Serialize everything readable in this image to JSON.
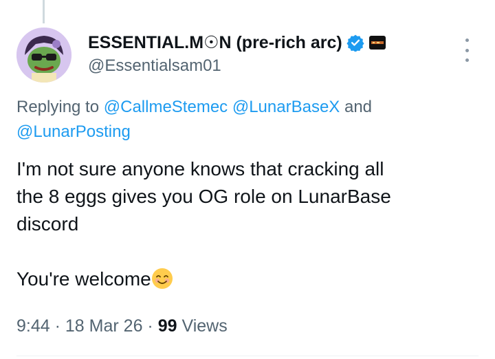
{
  "tweet": {
    "display_name": "ESSENTIAL.M☉N (pre-rich arc)",
    "handle": "@Essentialsam01",
    "replying_prefix": "Replying to",
    "mentions": [
      "@CallmeStemec",
      "@LunarBaseX",
      "@LunarPosting"
    ],
    "mention_joiner": "and",
    "body_lines": [
      "I'm not sure anyone knows that cracking all",
      "the 8 eggs gives you OG role on LunarBase",
      "discord"
    ],
    "closing_text": "You're welcome",
    "time": "9:44",
    "date": "18 Mar 26",
    "separator": "·",
    "views_count": "99",
    "views_label": "Views"
  },
  "colors": {
    "link": "#1d9bf0",
    "secondary_text": "#536471",
    "verified": "#1d9bf0",
    "avatar_bg": "#d7c6ef"
  },
  "icons": {
    "verified": "verified-badge-icon",
    "affiliate": "affiliate-badge-icon",
    "more": "more-options-icon",
    "emoji": "smiling-face-emoji"
  }
}
